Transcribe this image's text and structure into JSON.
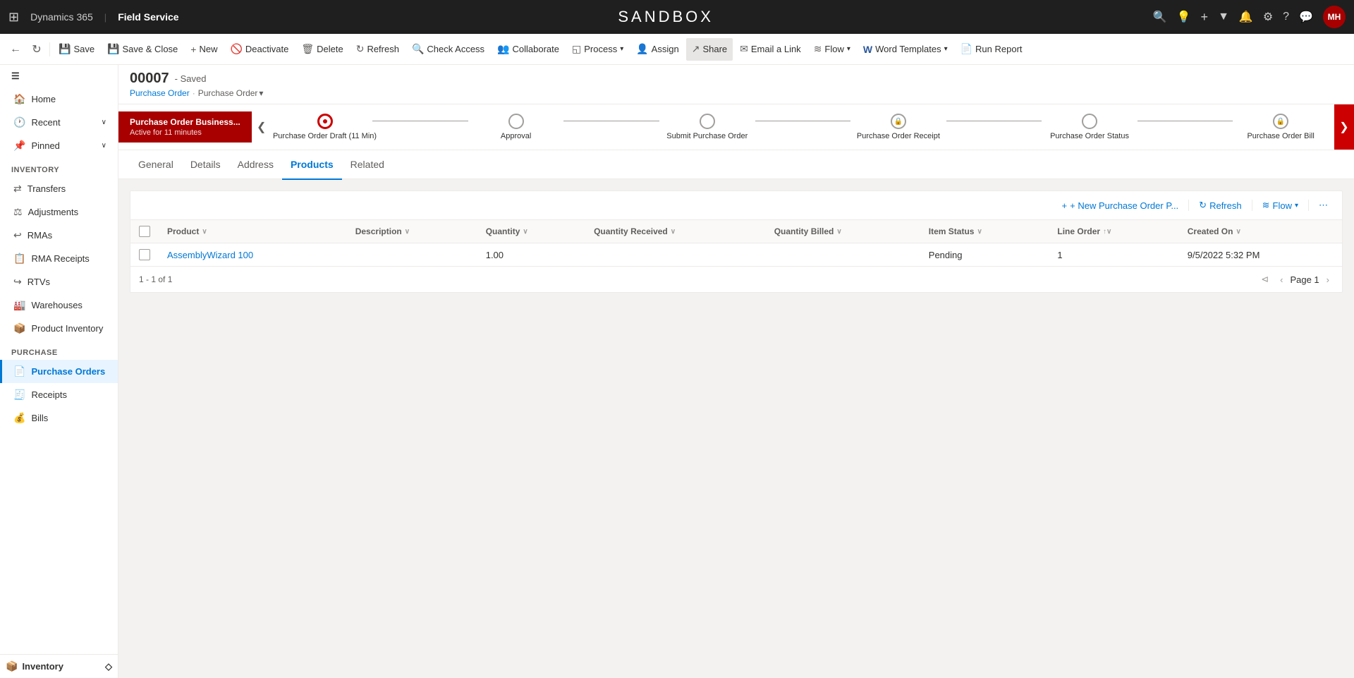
{
  "app": {
    "grid_icon": "⊞",
    "name": "Dynamics 365",
    "separator": "|",
    "module": "Field Service",
    "sandbox_title": "SANDBOX"
  },
  "top_nav_icons": [
    "🔍",
    "💡",
    "+",
    "🔽",
    "🔔",
    "⚙",
    "?",
    "💬"
  ],
  "avatar": {
    "initials": "MH",
    "bg": "#a80000"
  },
  "command_bar": {
    "back_arrow": "←",
    "forward_arrow": "↻",
    "buttons": [
      {
        "id": "save",
        "icon": "💾",
        "label": "Save"
      },
      {
        "id": "save-close",
        "icon": "💾",
        "label": "Save & Close"
      },
      {
        "id": "new",
        "icon": "+",
        "label": "New"
      },
      {
        "id": "deactivate",
        "icon": "🚫",
        "label": "Deactivate"
      },
      {
        "id": "delete",
        "icon": "🗑",
        "label": "Delete"
      },
      {
        "id": "refresh",
        "icon": "↻",
        "label": "Refresh"
      },
      {
        "id": "check-access",
        "icon": "🔍",
        "label": "Check Access"
      },
      {
        "id": "collaborate",
        "icon": "👥",
        "label": "Collaborate"
      },
      {
        "id": "process",
        "icon": "◱",
        "label": "Process",
        "hasDropdown": true
      },
      {
        "id": "assign",
        "icon": "👤",
        "label": "Assign"
      },
      {
        "id": "share",
        "icon": "↗",
        "label": "Share",
        "active": true
      },
      {
        "id": "email-link",
        "icon": "✉",
        "label": "Email a Link"
      },
      {
        "id": "flow",
        "icon": "≋",
        "label": "Flow",
        "hasDropdown": true
      },
      {
        "id": "word-templates",
        "icon": "W",
        "label": "Word Templates",
        "hasDropdown": true
      },
      {
        "id": "run-report",
        "icon": "📄",
        "label": "Run Report"
      }
    ]
  },
  "sidebar": {
    "collapse_icon": "☰",
    "sections": [
      {
        "id": "top",
        "items": [
          {
            "id": "home",
            "icon": "🏠",
            "label": "Home",
            "active": false,
            "hasChevron": false
          },
          {
            "id": "recent",
            "icon": "🕐",
            "label": "Recent",
            "active": false,
            "hasChevron": true
          },
          {
            "id": "pinned",
            "icon": "📌",
            "label": "Pinned",
            "active": false,
            "hasChevron": true
          }
        ]
      },
      {
        "id": "inventory",
        "label": "Inventory",
        "items": [
          {
            "id": "transfers",
            "icon": "⇄",
            "label": "Transfers"
          },
          {
            "id": "adjustments",
            "icon": "⚖",
            "label": "Adjustments"
          },
          {
            "id": "rmas",
            "icon": "↩",
            "label": "RMAs"
          },
          {
            "id": "rma-receipts",
            "icon": "📋",
            "label": "RMA Receipts"
          },
          {
            "id": "rtvs",
            "icon": "↪",
            "label": "RTVs"
          },
          {
            "id": "warehouses",
            "icon": "🏭",
            "label": "Warehouses"
          },
          {
            "id": "product-inventory",
            "icon": "📦",
            "label": "Product Inventory"
          }
        ]
      },
      {
        "id": "purchase",
        "label": "Purchase",
        "items": [
          {
            "id": "purchase-orders",
            "icon": "📄",
            "label": "Purchase Orders",
            "active": true
          },
          {
            "id": "receipts",
            "icon": "🧾",
            "label": "Receipts"
          },
          {
            "id": "bills",
            "icon": "💰",
            "label": "Bills"
          }
        ]
      }
    ],
    "footer": {
      "icon": "📦",
      "label": "Inventory",
      "chevron": "⋄"
    }
  },
  "record": {
    "id": "00007",
    "status": "- Saved",
    "breadcrumb": {
      "parent": "Purchase Order",
      "separator": "·",
      "current": "Purchase Order",
      "dropdown_icon": "▾"
    }
  },
  "process_bar": {
    "active_stage": {
      "name": "Purchase Order Business...",
      "time": "Active for 11 minutes"
    },
    "left_chevron": "❮",
    "right_chevron": "❯",
    "stages": [
      {
        "id": "draft",
        "label": "Purchase Order Draft  (11 Min)",
        "state": "active",
        "locked": false
      },
      {
        "id": "approval",
        "label": "Approval",
        "state": "normal",
        "locked": false
      },
      {
        "id": "submit",
        "label": "Submit Purchase Order",
        "state": "normal",
        "locked": false
      },
      {
        "id": "receipt",
        "label": "Purchase Order Receipt",
        "state": "normal",
        "locked": true
      },
      {
        "id": "status",
        "label": "Purchase Order Status",
        "state": "normal",
        "locked": false
      },
      {
        "id": "bill",
        "label": "Purchase Order Bill",
        "state": "normal",
        "locked": true
      }
    ]
  },
  "tabs": [
    {
      "id": "general",
      "label": "General"
    },
    {
      "id": "details",
      "label": "Details"
    },
    {
      "id": "address",
      "label": "Address"
    },
    {
      "id": "products",
      "label": "Products",
      "active": true
    },
    {
      "id": "related",
      "label": "Related"
    }
  ],
  "products_grid": {
    "toolbar": {
      "new_label": "+ New Purchase Order P...",
      "refresh_label": "Refresh",
      "flow_label": "Flow",
      "more_icon": "⋯"
    },
    "columns": [
      {
        "id": "product",
        "label": "Product",
        "sortable": true,
        "sort_icon": "∨"
      },
      {
        "id": "description",
        "label": "Description",
        "sortable": true,
        "sort_icon": "∨"
      },
      {
        "id": "quantity",
        "label": "Quantity",
        "sortable": true,
        "sort_icon": "∨"
      },
      {
        "id": "qty-received",
        "label": "Quantity Received",
        "sortable": true,
        "sort_icon": "∨"
      },
      {
        "id": "qty-billed",
        "label": "Quantity Billed",
        "sortable": true,
        "sort_icon": "∨"
      },
      {
        "id": "item-status",
        "label": "Item Status",
        "sortable": true,
        "sort_icon": "∨"
      },
      {
        "id": "line-order",
        "label": "Line Order",
        "sortable": true,
        "sort_icon": "↑∨"
      },
      {
        "id": "created-on",
        "label": "Created On",
        "sortable": true,
        "sort_icon": "∨"
      }
    ],
    "rows": [
      {
        "id": "row1",
        "product": "AssemblyWizard 100",
        "description": "",
        "quantity": "1.00",
        "qty_received": "",
        "qty_billed": "",
        "item_status": "Pending",
        "line_order": "1",
        "created_on": "9/5/2022 5:32 PM"
      }
    ],
    "pagination": {
      "summary": "1 - 1 of 1",
      "first": "⊲",
      "prev": "‹",
      "page_label": "Page 1",
      "next": "›"
    }
  }
}
